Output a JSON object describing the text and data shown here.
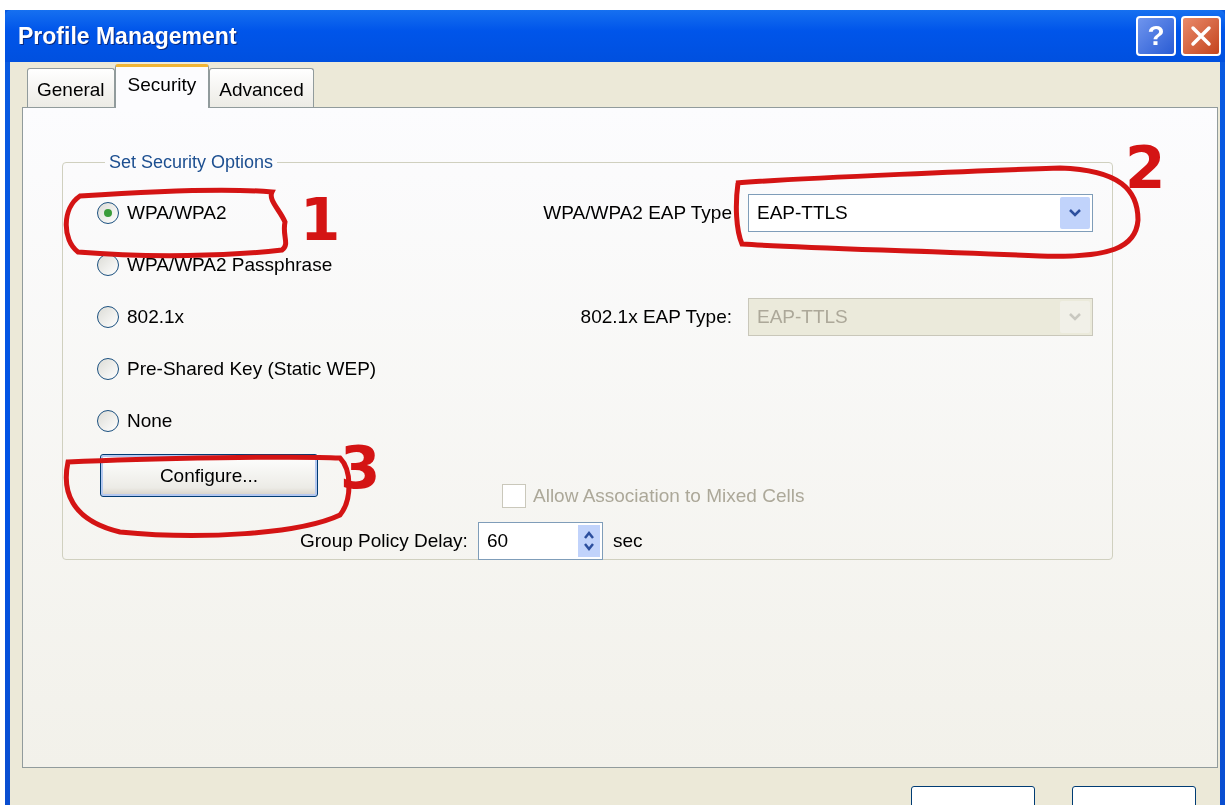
{
  "window": {
    "title": "Profile Management",
    "help_button": "?"
  },
  "tabs": [
    {
      "label": "General",
      "selected": false
    },
    {
      "label": "Security",
      "selected": true
    },
    {
      "label": "Advanced",
      "selected": false
    }
  ],
  "group": {
    "title": "Set Security Options"
  },
  "options": [
    {
      "label": "WPA/WPA2",
      "selected": true
    },
    {
      "label": "WPA/WPA2 Passphrase",
      "selected": false
    },
    {
      "label": "802.1x",
      "selected": false
    },
    {
      "label": "Pre-Shared Key (Static WEP)",
      "selected": false
    },
    {
      "label": "None",
      "selected": false
    }
  ],
  "eap_fields": [
    {
      "label": "WPA/WPA2 EAP Type",
      "value": "EAP-TTLS",
      "disabled": false
    },
    {
      "label": "802.1x EAP Type:",
      "value": "EAP-TTLS",
      "disabled": true
    }
  ],
  "configure_button": "Configure...",
  "mixed_cells": {
    "label": "Allow Association to Mixed Cells",
    "checked": false,
    "disabled": true
  },
  "group_policy": {
    "label": "Group Policy Delay:",
    "value": "60",
    "unit": "sec"
  },
  "annotations": [
    {
      "label": "1"
    },
    {
      "label": "2"
    },
    {
      "label": "3"
    }
  ]
}
